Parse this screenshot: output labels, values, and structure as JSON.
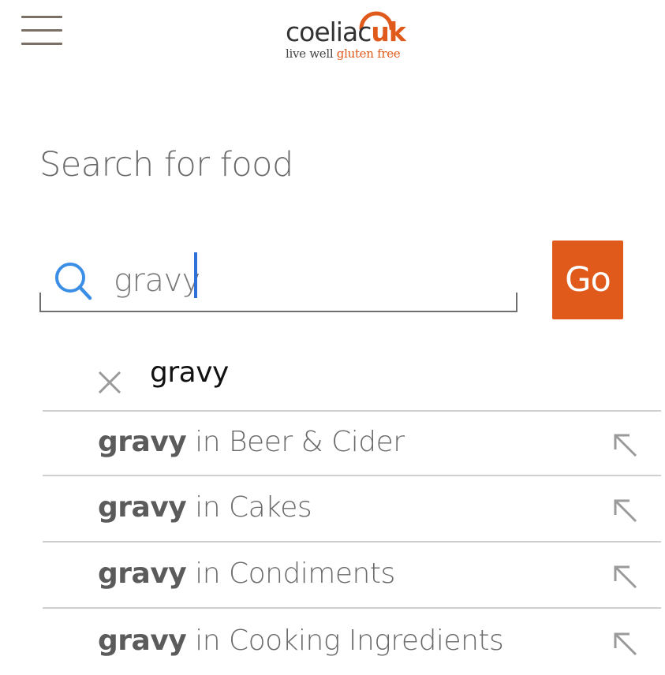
{
  "header": {
    "menu_icon": "hamburger-menu-icon",
    "logo": {
      "name_main": "coeliac",
      "name_accent": "uk",
      "tagline_main": "live well ",
      "tagline_accent": "gluten free"
    }
  },
  "page_title": "Search for food",
  "search": {
    "icon": "search-icon",
    "value": "gravy",
    "go_label": "Go"
  },
  "autocomplete": {
    "query": "gravy",
    "clear_icon": "close-icon",
    "items": [
      {
        "keyword": "gravy",
        "connector": " in ",
        "category": "Beer & Cider",
        "icon": "arrow-up-left-icon"
      },
      {
        "keyword": "gravy",
        "connector": " in ",
        "category": "Cakes",
        "icon": "arrow-up-left-icon"
      },
      {
        "keyword": "gravy",
        "connector": " in ",
        "category": "Condiments",
        "icon": "arrow-up-left-icon"
      },
      {
        "keyword": "gravy",
        "connector": " in ",
        "category": "Cooking Ingredients",
        "icon": "arrow-up-left-icon"
      }
    ]
  },
  "colors": {
    "brand_orange": "#e05a1b",
    "caret_blue": "#2f6fd6",
    "search_icon_blue": "#3a8ee6"
  }
}
